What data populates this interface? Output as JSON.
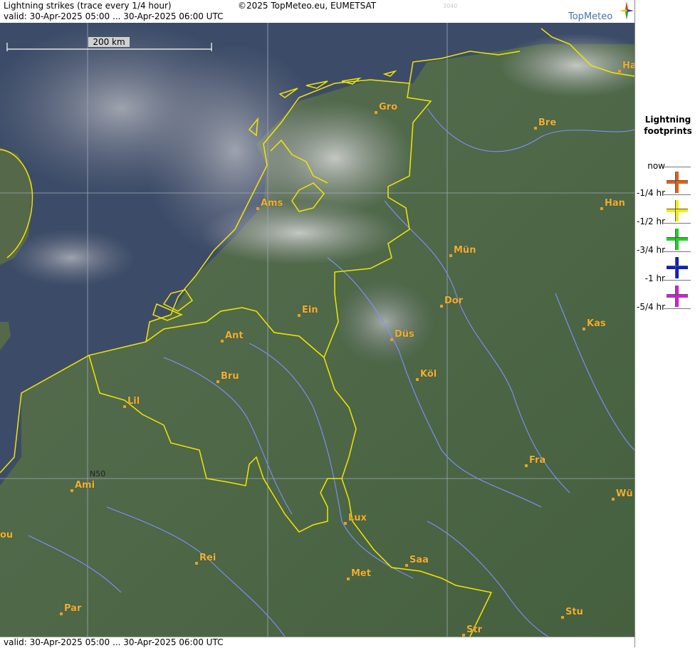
{
  "header": {
    "title": "Lightning strikes (trace every 1/4 hour)",
    "valid": "valid:  30-Apr-2025 05:00 ... 30-Apr-2025 06:00 UTC",
    "copyright": "©2025 TopMeteo.eu, EUMETSAT",
    "faint_text": "3040"
  },
  "logo": {
    "text": "TopMeteo"
  },
  "footer": {
    "valid": "valid:  30-Apr-2025 05:00 ... 30-Apr-2025 06:00 UTC"
  },
  "map": {
    "scale_label": "200 km",
    "grid_label": "N50",
    "colors": {
      "borders": "#f2e600",
      "rivers": "#8090ff",
      "grid": "#a0a8b8",
      "city": "#f0b030"
    },
    "cities": [
      {
        "name": "Ha"
      },
      {
        "name": "Gro"
      },
      {
        "name": "Bre"
      },
      {
        "name": "Ams"
      },
      {
        "name": "Han"
      },
      {
        "name": "Mün"
      },
      {
        "name": "Dor"
      },
      {
        "name": "Ein"
      },
      {
        "name": "Kas"
      },
      {
        "name": "Ant"
      },
      {
        "name": "Düs"
      },
      {
        "name": "Bru"
      },
      {
        "name": "Köl"
      },
      {
        "name": "Lil"
      },
      {
        "name": "Fra"
      },
      {
        "name": "Ami"
      },
      {
        "name": "Wü"
      },
      {
        "name": "Lux"
      },
      {
        "name": "ou"
      },
      {
        "name": "Rei"
      },
      {
        "name": "Saa"
      },
      {
        "name": "Met"
      },
      {
        "name": "Par"
      },
      {
        "name": "Stu"
      },
      {
        "name": "Str"
      }
    ]
  },
  "legend": {
    "title_line1": "Lightning",
    "title_line2": "footprints",
    "items": [
      {
        "label": "now",
        "color": ""
      },
      {
        "label": "-1/4 hr",
        "color": "#e0601a"
      },
      {
        "label": "-1/2 hr",
        "color": "#f0f000"
      },
      {
        "label": "-3/4 hr",
        "color": "#20d020"
      },
      {
        "label": "-1 hr",
        "color": "#1020c0"
      },
      {
        "label": "-5/4 hr",
        "color": "#d020d0"
      }
    ]
  }
}
